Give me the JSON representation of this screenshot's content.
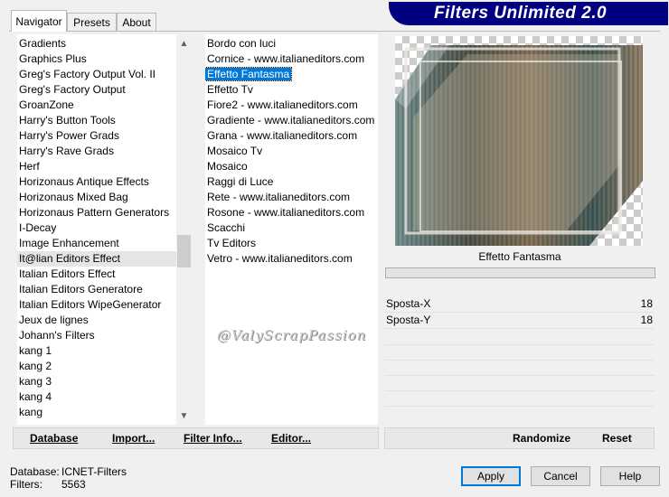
{
  "banner": {
    "title": "Filters Unlimited 2.0"
  },
  "tabs": [
    {
      "label": "Navigator"
    },
    {
      "label": "Presets"
    },
    {
      "label": "About"
    }
  ],
  "categories": [
    "Gradients",
    "Graphics Plus",
    "Greg's Factory Output Vol. II",
    "Greg's Factory Output",
    "GroanZone",
    "Harry's Button Tools",
    "Harry's Power Grads",
    "Harry's Rave Grads",
    "Herf",
    "Horizonaus Antique Effects",
    "Horizonaus Mixed Bag",
    "Horizonaus Pattern Generators",
    "I-Decay",
    "Image Enhancement",
    "It@lian Editors Effect",
    "Italian Editors Effect",
    "Italian Editors Generatore",
    "Italian Editors WipeGenerator",
    "Jeux de lignes",
    "Johann's Filters",
    "kang 1",
    "kang 2",
    "kang 3",
    "kang 4",
    "kang"
  ],
  "filters": [
    "Bordo con luci",
    "Cornice - www.italianeditors.com",
    "Effetto Fantasma",
    "Effetto Tv",
    "Fiore2 - www.italianeditors.com",
    "Gradiente - www.italianeditors.com",
    "Grana - www.italianeditors.com",
    "Mosaico Tv",
    "Mosaico",
    "Raggi di Luce",
    "Rete - www.italianeditors.com",
    "Rosone - www.italianeditors.com",
    "Scacchi",
    "Tv Editors",
    "Vetro - www.italianeditors.com"
  ],
  "selected_category": "It@lian Editors Effect",
  "selected_filter": "Effetto Fantasma",
  "watermark": "@ValyScrapPassion",
  "params": {
    "filter_name": "Effetto Fantasma",
    "rows": [
      {
        "label": "Sposta-X",
        "value": "18"
      },
      {
        "label": "Sposta-Y",
        "value": "18"
      }
    ]
  },
  "buttons": {
    "database": "Database",
    "import": "Import...",
    "filter_info": "Filter Info...",
    "editor": "Editor...",
    "randomize": "Randomize",
    "reset": "Reset",
    "apply": "Apply",
    "cancel": "Cancel",
    "help": "Help"
  },
  "status": {
    "database_label": "Database:",
    "database_value": "ICNET-Filters",
    "filters_label": "Filters:",
    "filters_value": "5563"
  },
  "colors": {
    "banner": "#000080",
    "selection": "#0078d7"
  }
}
